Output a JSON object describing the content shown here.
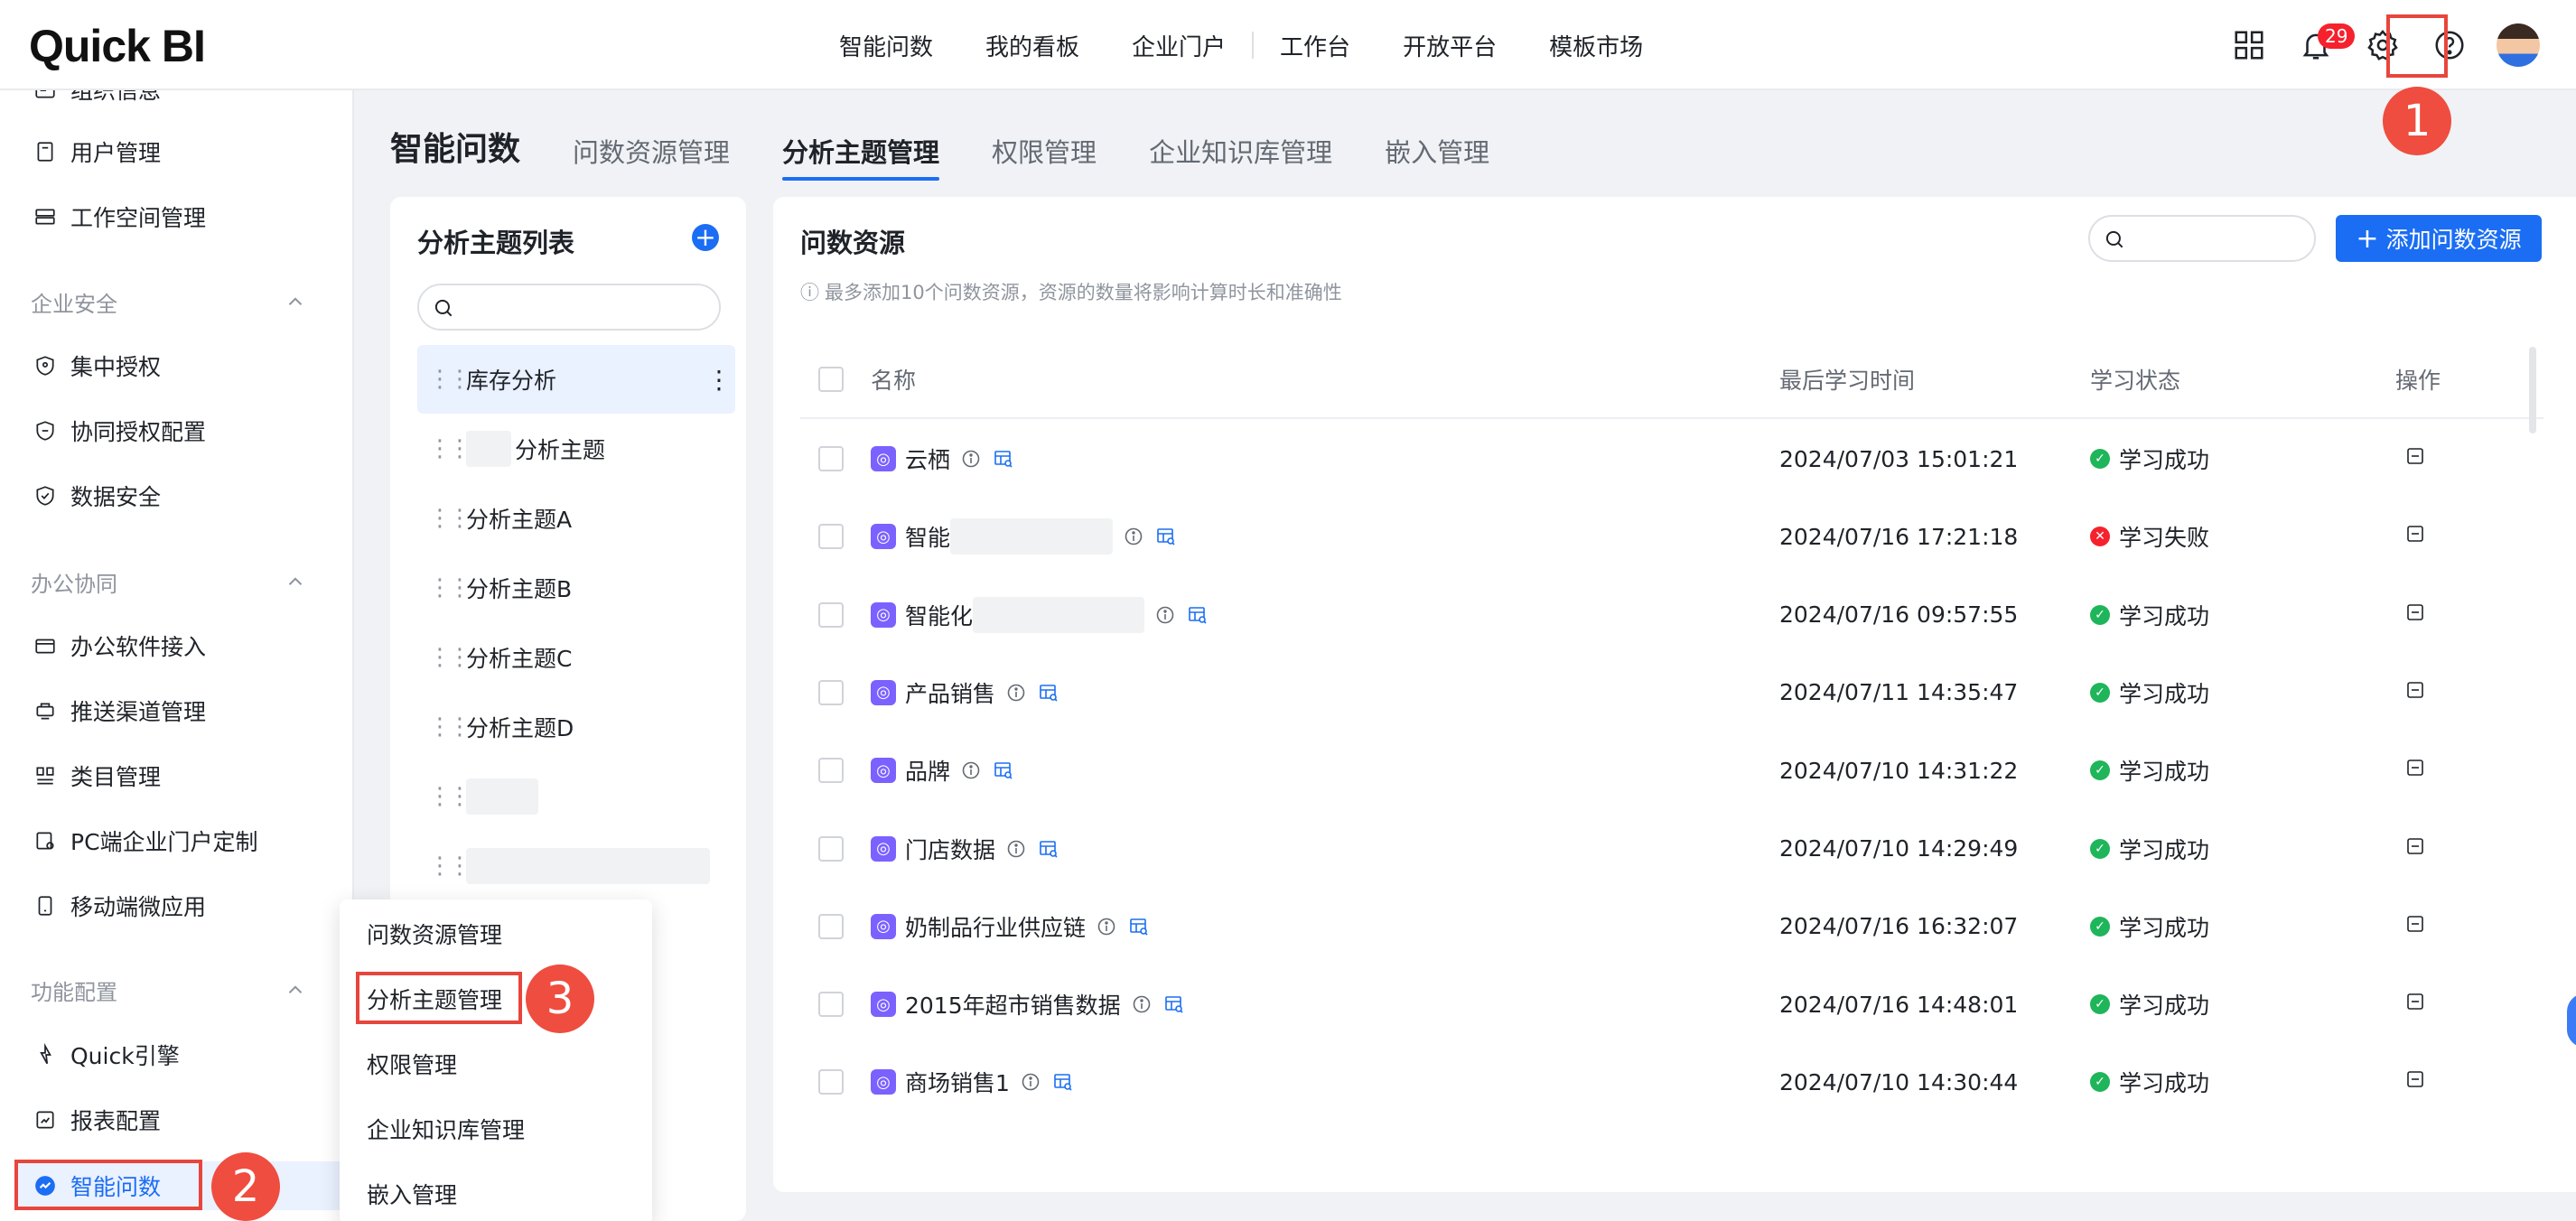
{
  "app": {
    "logo": "Quick BI"
  },
  "topnav": {
    "items": [
      "智能问数",
      "我的看板",
      "企业门户",
      "工作台",
      "开放平台",
      "模板市场"
    ]
  },
  "notifications": {
    "count": "29"
  },
  "steps": [
    "1",
    "2",
    "3"
  ],
  "sidebar": {
    "items_a": [
      {
        "label": "组织信息",
        "icon": "org-icon"
      },
      {
        "label": "用户管理",
        "icon": "user-doc-icon"
      },
      {
        "label": "工作空间管理",
        "icon": "workspace-icon"
      }
    ],
    "group_security": "企业安全",
    "items_security": [
      {
        "label": "集中授权",
        "icon": "shield-icon"
      },
      {
        "label": "协同授权配置",
        "icon": "shield-icon"
      },
      {
        "label": "数据安全",
        "icon": "shield-check-icon"
      }
    ],
    "group_office": "办公协同",
    "items_office": [
      {
        "label": "办公软件接入",
        "icon": "office-icon"
      },
      {
        "label": "推送渠道管理",
        "icon": "push-icon"
      },
      {
        "label": "类目管理",
        "icon": "category-icon"
      },
      {
        "label": "PC端企业门户定制",
        "icon": "pc-icon"
      },
      {
        "label": "移动端微应用",
        "icon": "mobile-icon"
      }
    ],
    "group_function": "功能配置",
    "items_function": [
      {
        "label": "Quick引擎",
        "icon": "engine-icon"
      },
      {
        "label": "报表配置",
        "icon": "report-icon"
      },
      {
        "label": "智能问数",
        "icon": "smart-qa-icon"
      }
    ]
  },
  "popup_menu": [
    "问数资源管理",
    "分析主题管理",
    "权限管理",
    "企业知识库管理",
    "嵌入管理"
  ],
  "header": {
    "title": "智能问数",
    "tabs": [
      "问数资源管理",
      "分析主题管理",
      "权限管理",
      "企业知识库管理",
      "嵌入管理"
    ],
    "active_tab": "分析主题管理"
  },
  "topics": {
    "title": "分析主题列表",
    "search_placeholder": "",
    "items": [
      "库存分析",
      "分析主题",
      "分析主题A",
      "分析主题B",
      "分析主题C",
      "分析主题D",
      "",
      ""
    ]
  },
  "resources": {
    "title": "问数资源",
    "note": "最多添加10个问数资源，资源的数量将影响计算时长和准确性",
    "search_placeholder": "",
    "add_button": "添加问数资源",
    "columns": {
      "name": "名称",
      "time": "最后学习时间",
      "status": "学习状态",
      "action": "操作"
    },
    "rows": [
      {
        "name": "云栖",
        "time": "2024/07/03 15:01:21",
        "status": "学习成功",
        "ok": true
      },
      {
        "name": "智能",
        "time": "2024/07/16 17:21:18",
        "status": "学习失败",
        "ok": false
      },
      {
        "name": "智能化",
        "time": "2024/07/16 09:57:55",
        "status": "学习成功",
        "ok": true
      },
      {
        "name": "产品销售",
        "time": "2024/07/11 14:35:47",
        "status": "学习成功",
        "ok": true
      },
      {
        "name": "品牌",
        "time": "2024/07/10 14:31:22",
        "status": "学习成功",
        "ok": true
      },
      {
        "name": "门店数据",
        "time": "2024/07/10 14:29:49",
        "status": "学习成功",
        "ok": true
      },
      {
        "name": "奶制品行业供应链",
        "time": "2024/07/16 16:32:07",
        "status": "学习成功",
        "ok": true
      },
      {
        "name": "2015年超市销售数据",
        "time": "2024/07/16 14:48:01",
        "status": "学习成功",
        "ok": true
      },
      {
        "name": "商场销售1",
        "time": "2024/07/10 14:30:44",
        "status": "学习成功",
        "ok": true
      }
    ]
  },
  "colors": {
    "accent": "#1b6ef3",
    "success": "#1fb55a",
    "error": "#f5222d",
    "highlight": "#e8453c"
  }
}
